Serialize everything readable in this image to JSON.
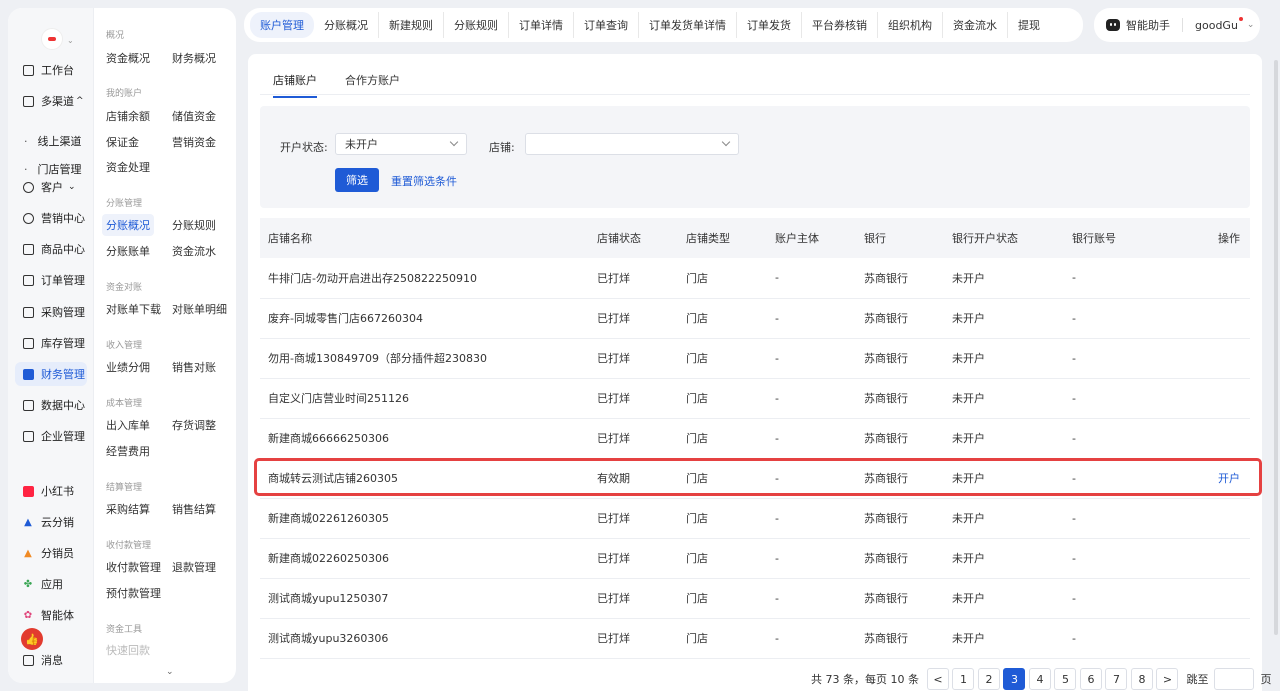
{
  "sidebar": {
    "items": [
      {
        "label": "工作台",
        "icon": "monitor-icon"
      },
      {
        "label": "多渠道",
        "icon": "store-icon"
      },
      {
        "label": "线上渠道"
      },
      {
        "label": "门店管理"
      },
      {
        "label": "客户",
        "icon": "user-icon"
      },
      {
        "label": "营销中心",
        "icon": "target-icon"
      },
      {
        "label": "商品中心",
        "icon": "shop-icon"
      },
      {
        "label": "订单管理",
        "icon": "document-icon"
      },
      {
        "label": "采购管理",
        "icon": "cart-icon"
      },
      {
        "label": "库存管理",
        "icon": "warehouse-icon"
      },
      {
        "label": "财务管理",
        "icon": "finance-icon"
      },
      {
        "label": "数据中心",
        "icon": "bar-chart-icon"
      },
      {
        "label": "企业管理",
        "icon": "building-icon"
      },
      {
        "label": "小红书",
        "icon": "xiaohongshu-icon"
      },
      {
        "label": "云分销",
        "icon": "cloud-icon"
      },
      {
        "label": "分销员",
        "icon": "people-icon"
      },
      {
        "label": "应用",
        "icon": "apps-icon"
      },
      {
        "label": "智能体",
        "icon": "agent-icon"
      },
      {
        "label": "消息",
        "icon": "message-icon"
      }
    ],
    "caret_up": "^",
    "caret_down": "⌄"
  },
  "subnav": {
    "groups": [
      {
        "title": "概况",
        "items": [
          "资金概况",
          "财务概况"
        ]
      },
      {
        "title": "我的账户",
        "items": [
          "店铺余额",
          "储值资金",
          "保证金",
          "营销资金",
          "资金处理"
        ]
      },
      {
        "title": "分账管理",
        "items": [
          "分账概况",
          "分账规则",
          "分账账单",
          "资金流水"
        ]
      },
      {
        "title": "资金对账",
        "items": [
          "对账单下载",
          "对账单明细"
        ]
      },
      {
        "title": "收入管理",
        "items": [
          "业绩分佣",
          "销售对账"
        ]
      },
      {
        "title": "成本管理",
        "items": [
          "出入库单",
          "存货调整",
          "经营费用"
        ]
      },
      {
        "title": "结算管理",
        "items": [
          "采购结算",
          "销售结算"
        ]
      },
      {
        "title": "收付款管理",
        "items": [
          "收付款管理",
          "退款管理",
          "预付款管理"
        ]
      },
      {
        "title": "资金工具",
        "items": [
          "快速回款"
        ]
      }
    ]
  },
  "topbar": {
    "tabs": [
      "账户管理",
      "分账概况",
      "新建规则",
      "分账规则",
      "订单详情",
      "订单查询",
      "订单发货单详情",
      "订单发货",
      "平台券核销",
      "组织机构",
      "资金流水",
      "提现"
    ],
    "assistant": "智能助手",
    "user": "goodGu"
  },
  "main": {
    "subtabs": [
      "店铺账户",
      "合作方账户"
    ],
    "filter": {
      "status_label": "开户状态:",
      "status_value": "未开户",
      "store_label": "店铺:",
      "store_value": "",
      "submit": "筛选",
      "reset": "重置筛选条件"
    },
    "table": {
      "headers": [
        "店铺名称",
        "店铺状态",
        "店铺类型",
        "账户主体",
        "银行",
        "银行开户状态",
        "银行账号",
        "操作"
      ],
      "rows": [
        {
          "name": "牛排门店-勿动开启进出存250822250910",
          "status": "已打烊",
          "type": "门店",
          "entity": "-",
          "bank": "苏商银行",
          "open": "未开户",
          "account": "-",
          "op": ""
        },
        {
          "name": "废弃-同城零售门店667260304",
          "status": "已打烊",
          "type": "门店",
          "entity": "-",
          "bank": "苏商银行",
          "open": "未开户",
          "account": "-",
          "op": ""
        },
        {
          "name": "勿用-商城130849709（部分插件超230830",
          "status": "已打烊",
          "type": "门店",
          "entity": "-",
          "bank": "苏商银行",
          "open": "未开户",
          "account": "-",
          "op": ""
        },
        {
          "name": "自定义门店营业时间251126",
          "status": "已打烊",
          "type": "门店",
          "entity": "-",
          "bank": "苏商银行",
          "open": "未开户",
          "account": "-",
          "op": ""
        },
        {
          "name": "新建商城66666250306",
          "status": "已打烊",
          "type": "门店",
          "entity": "-",
          "bank": "苏商银行",
          "open": "未开户",
          "account": "-",
          "op": ""
        },
        {
          "name": "商城转云测试店铺260305",
          "status": "有效期",
          "type": "门店",
          "entity": "-",
          "bank": "苏商银行",
          "open": "未开户",
          "account": "-",
          "op": "开户"
        },
        {
          "name": "新建商城02261260305",
          "status": "已打烊",
          "type": "门店",
          "entity": "-",
          "bank": "苏商银行",
          "open": "未开户",
          "account": "-",
          "op": ""
        },
        {
          "name": "新建商城02260250306",
          "status": "已打烊",
          "type": "门店",
          "entity": "-",
          "bank": "苏商银行",
          "open": "未开户",
          "account": "-",
          "op": ""
        },
        {
          "name": "测试商城yupu1250307",
          "status": "已打烊",
          "type": "门店",
          "entity": "-",
          "bank": "苏商银行",
          "open": "未开户",
          "account": "-",
          "op": ""
        },
        {
          "name": "测试商城yupu3260306",
          "status": "已打烊",
          "type": "门店",
          "entity": "-",
          "bank": "苏商银行",
          "open": "未开户",
          "account": "-",
          "op": ""
        }
      ]
    },
    "pagination": {
      "summary": "共 73 条，每页 10 条",
      "prev": "<",
      "next": ">",
      "pages": [
        "1",
        "2",
        "3",
        "4",
        "5",
        "6",
        "7",
        "8"
      ],
      "current": "3",
      "jump_label": "跳至",
      "page_suffix": "页"
    }
  },
  "colors": {
    "accent": "#1f5bd6",
    "highlight": "#e54141"
  }
}
